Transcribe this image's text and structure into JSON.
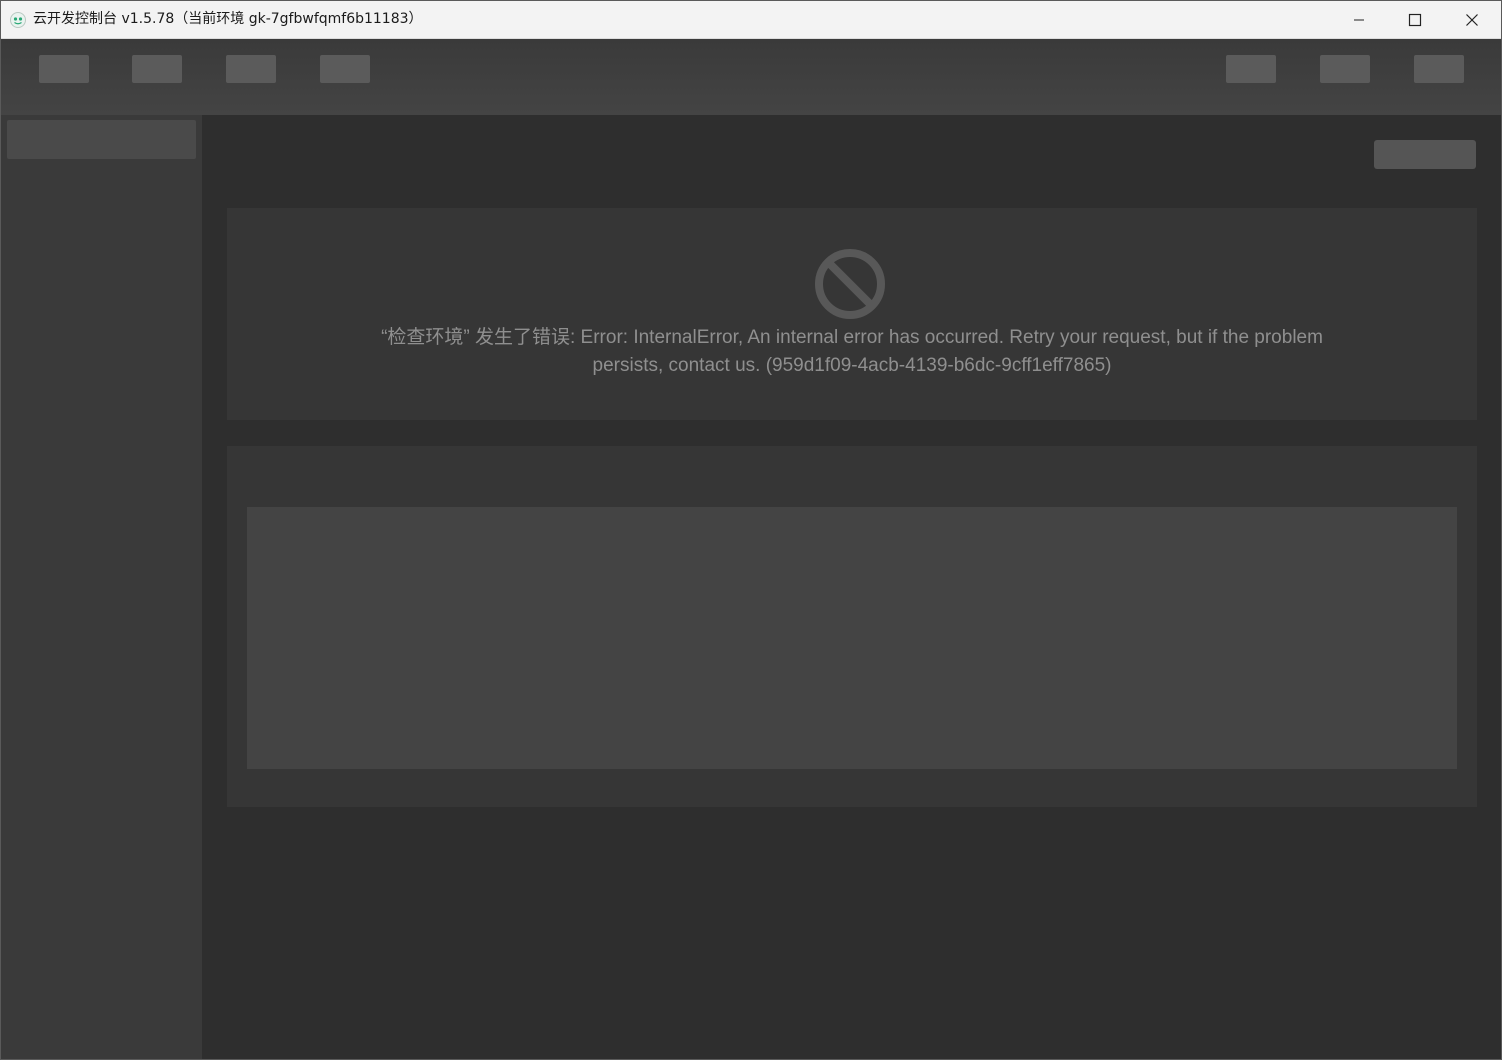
{
  "window": {
    "title": "云开发控制台 v1.5.78（当前环境 gk-7gfbwfqmf6b11183）",
    "icons": {
      "app": "cloudbase-app-icon",
      "minimize": "minimize-icon",
      "maximize": "maximize-icon",
      "close": "close-icon"
    }
  },
  "error": {
    "icon": "ban-icon",
    "message": "“检查环境” 发生了错误: Error: InternalError, An internal error has occurred. Retry your request, but if the problem persists, contact us. (959d1f09-4acb-4139-b6dc-9cff1eff7865)"
  },
  "colors": {
    "titlebar_bg": "#f3f3f3",
    "header_bg": "#3f3f3f",
    "sidebar_bg": "#3a3a3a",
    "main_bg": "#2e2e2e",
    "panel_bg": "#363636",
    "placeholder": "#5b5b5b",
    "error_text": "#8f8f8f"
  }
}
